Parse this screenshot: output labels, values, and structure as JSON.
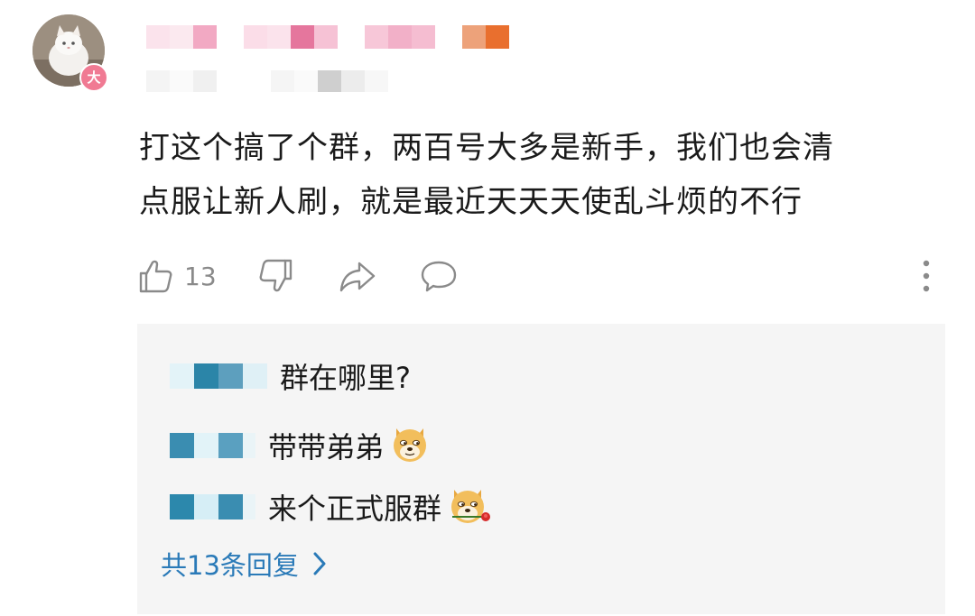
{
  "comment": {
    "author": {
      "avatar_icon": "cat-avatar",
      "level_badge": "大"
    },
    "text_line1": "打这个搞了个群，两百号大多是新手，我们也会清",
    "text_line2": "点服让新人刷，就是最近天天天使乱斗烦的不行",
    "actions": {
      "like_icon": "thumbs-up-icon",
      "like_count": "13",
      "dislike_icon": "thumbs-down-icon",
      "share_icon": "share-icon",
      "reply_icon": "comment-bubble-icon",
      "more_icon": "more-vertical-icon"
    }
  },
  "replies": {
    "items": [
      {
        "text": "群在哪里?",
        "emoji": ""
      },
      {
        "text": "带带弟弟",
        "emoji": "doge-emoji"
      },
      {
        "text": "来个正式服群",
        "emoji": "doge-rose-emoji"
      }
    ],
    "view_all_label": "共13条回复"
  },
  "colors": {
    "link": "#2a7ab8",
    "badge": "#f07a93",
    "muted_icon": "#8a8a8a",
    "reply_bg": "#f5f5f5"
  }
}
